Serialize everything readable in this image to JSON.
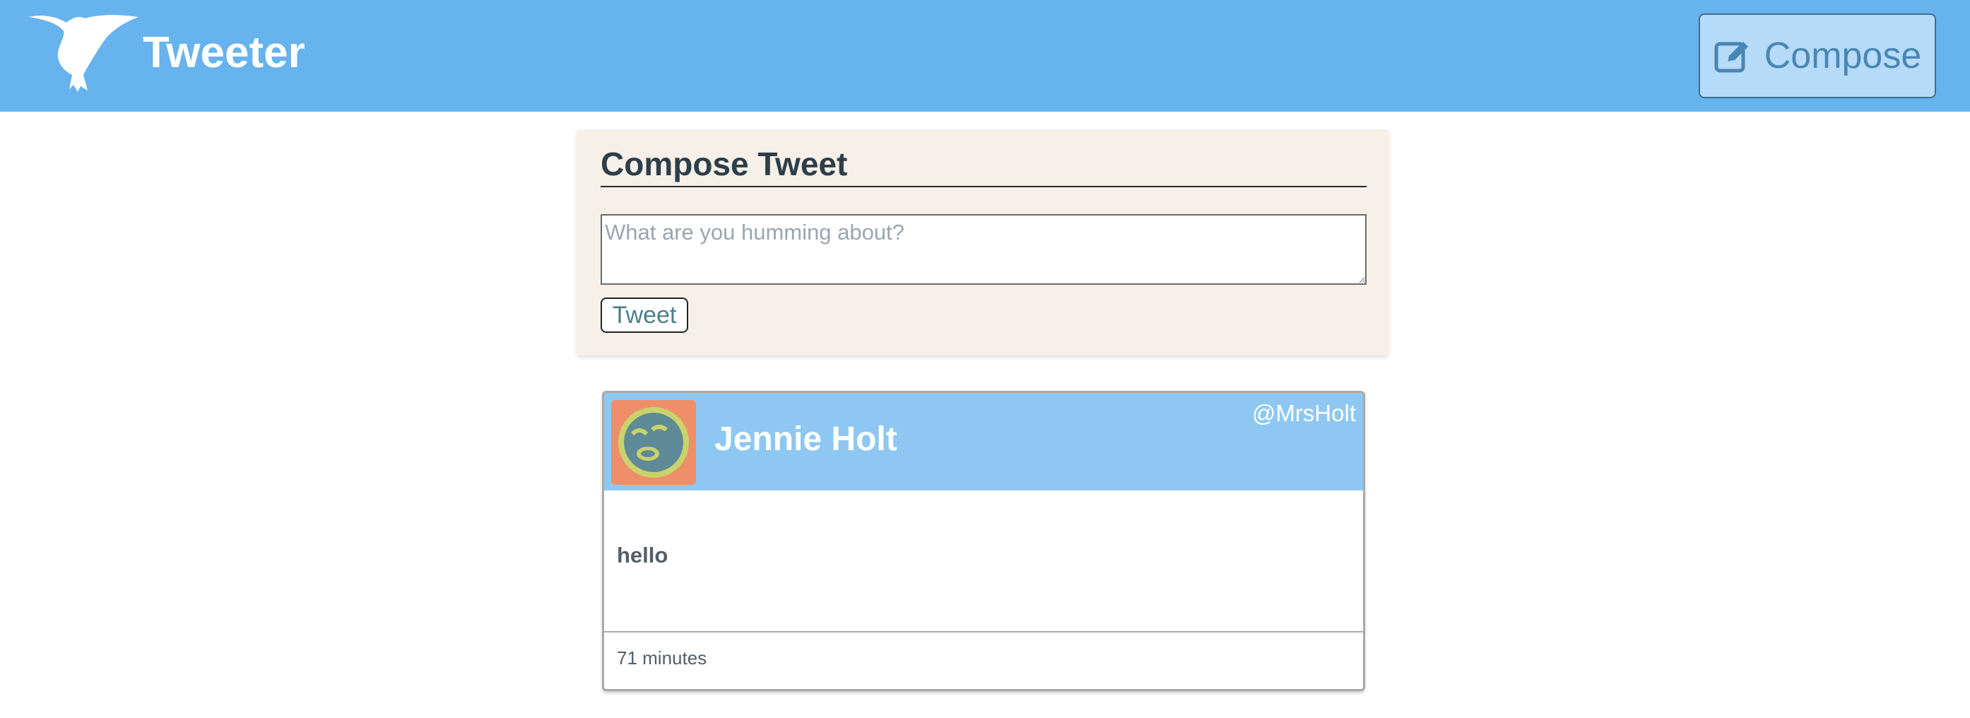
{
  "header": {
    "brand_name": "Tweeter",
    "logo_icon": "hummingbird-icon",
    "compose_label": "Compose",
    "compose_icon": "edit-icon",
    "accent_color": "#66b3ee"
  },
  "compose": {
    "heading": "Compose Tweet",
    "placeholder": "What are you humming about?",
    "value": "",
    "submit_label": "Tweet",
    "background_color": "#f6f0e9"
  },
  "tweets": [
    {
      "avatar_icon": "face-avatar-icon",
      "name": "Jennie Holt",
      "handle": "@MrsHolt",
      "content": "hello",
      "timestamp": "71 minutes",
      "header_color": "#8ec8f2"
    }
  ]
}
